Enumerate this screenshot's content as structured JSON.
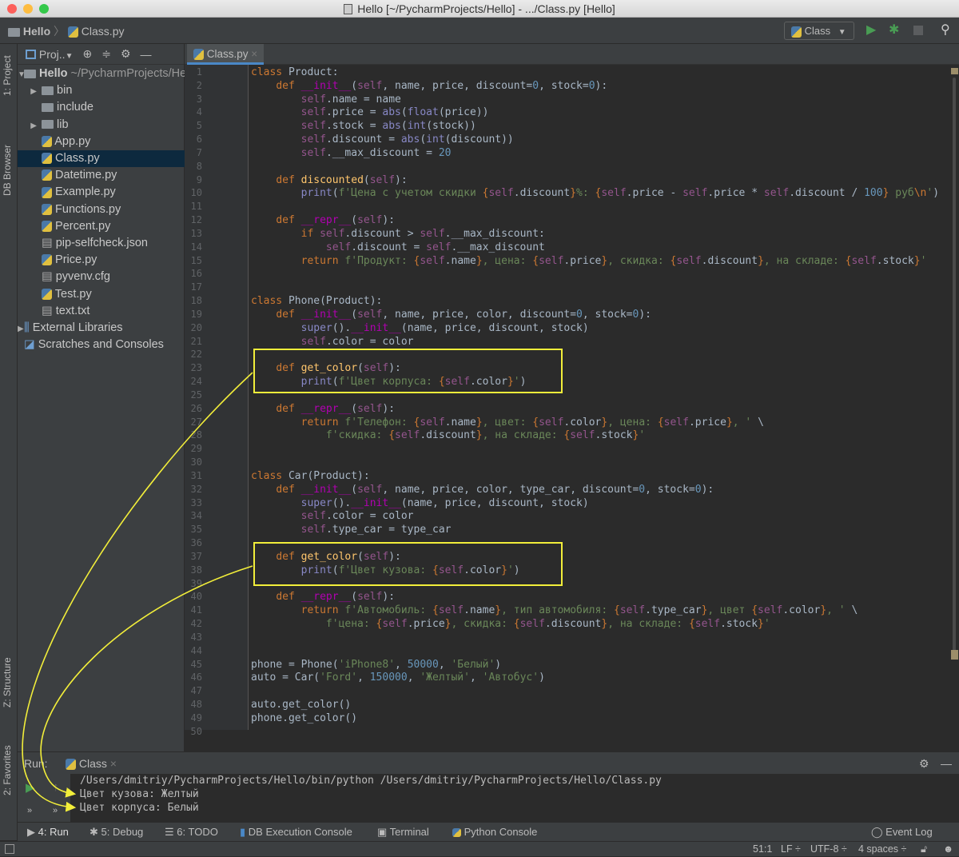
{
  "window": {
    "title": "Hello [~/PycharmProjects/Hello] - .../Class.py [Hello]"
  },
  "navbar": {
    "crumbs": [
      "Hello",
      "Class.py"
    ],
    "run_config": "Class"
  },
  "left_strip": {
    "tabs": [
      "1: Project",
      "DB Browser",
      "Z: Structure",
      "2: Favorites"
    ]
  },
  "project": {
    "view_label": "Proj..",
    "tree": [
      {
        "label": "Hello",
        "suffix": "~/PycharmProjects/Hello",
        "type": "folder",
        "level": 0,
        "expanded": true,
        "bold": true
      },
      {
        "label": "bin",
        "type": "folder",
        "level": 1,
        "expanded": false
      },
      {
        "label": "include",
        "type": "folder",
        "level": 1
      },
      {
        "label": "lib",
        "type": "folder",
        "level": 1,
        "expanded": false
      },
      {
        "label": "App.py",
        "type": "py",
        "level": 1
      },
      {
        "label": "Class.py",
        "type": "py",
        "level": 1,
        "selected": true
      },
      {
        "label": "Datetime.py",
        "type": "py",
        "level": 1
      },
      {
        "label": "Example.py",
        "type": "py",
        "level": 1
      },
      {
        "label": "Functions.py",
        "type": "py",
        "level": 1
      },
      {
        "label": "Percent.py",
        "type": "py",
        "level": 1
      },
      {
        "label": "pip-selfcheck.json",
        "type": "json",
        "level": 1
      },
      {
        "label": "Price.py",
        "type": "py",
        "level": 1
      },
      {
        "label": "pyvenv.cfg",
        "type": "cfg",
        "level": 1
      },
      {
        "label": "Test.py",
        "type": "py",
        "level": 1
      },
      {
        "label": "text.txt",
        "type": "txt",
        "level": 1
      },
      {
        "label": "External Libraries",
        "type": "lib",
        "level": 0,
        "expanded": false
      },
      {
        "label": "Scratches and Consoles",
        "type": "scratch",
        "level": 0
      }
    ]
  },
  "editor": {
    "tab": "Class.py",
    "lines": [
      "class Product:",
      "    def __init__(self, name, price, discount=0, stock=0):",
      "        self.name = name",
      "        self.price = abs(float(price))",
      "        self.stock = abs(int(stock))",
      "        self.discount = abs(int(discount))",
      "        self.__max_discount = 20",
      "",
      "    def discounted(self):",
      "        print(f'Цена с учетом скидки {self.discount}%: {self.price - self.price * self.discount / 100} руб\\n')",
      "",
      "    def __repr__(self):",
      "        if self.discount > self.__max_discount:",
      "            self.discount = self.__max_discount",
      "        return f'Продукт: {self.name}, цена: {self.price}, скидка: {self.discount}, на складе: {self.stock}'",
      "",
      "",
      "class Phone(Product):",
      "    def __init__(self, name, price, color, discount=0, stock=0):",
      "        super().__init__(name, price, discount, stock)",
      "        self.color = color",
      "",
      "    def get_color(self):",
      "        print(f'Цвет корпуса: {self.color}')",
      "",
      "    def __repr__(self):",
      "        return f'Телефон: {self.name}, цвет: {self.color}, цена: {self.price}, ' \\",
      "            f'скидка: {self.discount}, на складе: {self.stock}'",
      "",
      "",
      "class Car(Product):",
      "    def __init__(self, name, price, color, type_car, discount=0, stock=0):",
      "        super().__init__(name, price, discount, stock)",
      "        self.color = color",
      "        self.type_car = type_car",
      "",
      "    def get_color(self):",
      "        print(f'Цвет кузова: {self.color}')",
      "",
      "    def __repr__(self):",
      "        return f'Автомобиль: {self.name}, тип автомобиля: {self.type_car}, цвет {self.color}, ' \\",
      "            f'цена: {self.price}, скидка: {self.discount}, на складе: {self.stock}'",
      "",
      "",
      "phone = Phone('iPhone8', 50000, 'Белый')",
      "auto = Car('Ford', 150000, 'Желтый', 'Автобус')",
      "",
      "auto.get_color()",
      "phone.get_color()",
      ""
    ]
  },
  "run": {
    "label": "Run:",
    "tab": "Class",
    "output": [
      "/Users/dmitriy/PycharmProjects/Hello/bin/python /Users/dmitriy/PycharmProjects/Hello/Class.py",
      "Цвет кузова: Желтый",
      "Цвет корпуса: Белый"
    ]
  },
  "toolwindows": [
    "4: Run",
    "5: Debug",
    "6: TODO",
    "DB Execution Console",
    "Terminal",
    "Python Console"
  ],
  "event_log": "Event Log",
  "status": {
    "position": "51:1",
    "line_sep": "LF ÷",
    "encoding": "UTF-8 ÷",
    "indent": "4 spaces ÷"
  },
  "colors": {
    "annotation": "#f2ee3a",
    "accent": "#4a88c7",
    "run_green": "#499c54"
  }
}
